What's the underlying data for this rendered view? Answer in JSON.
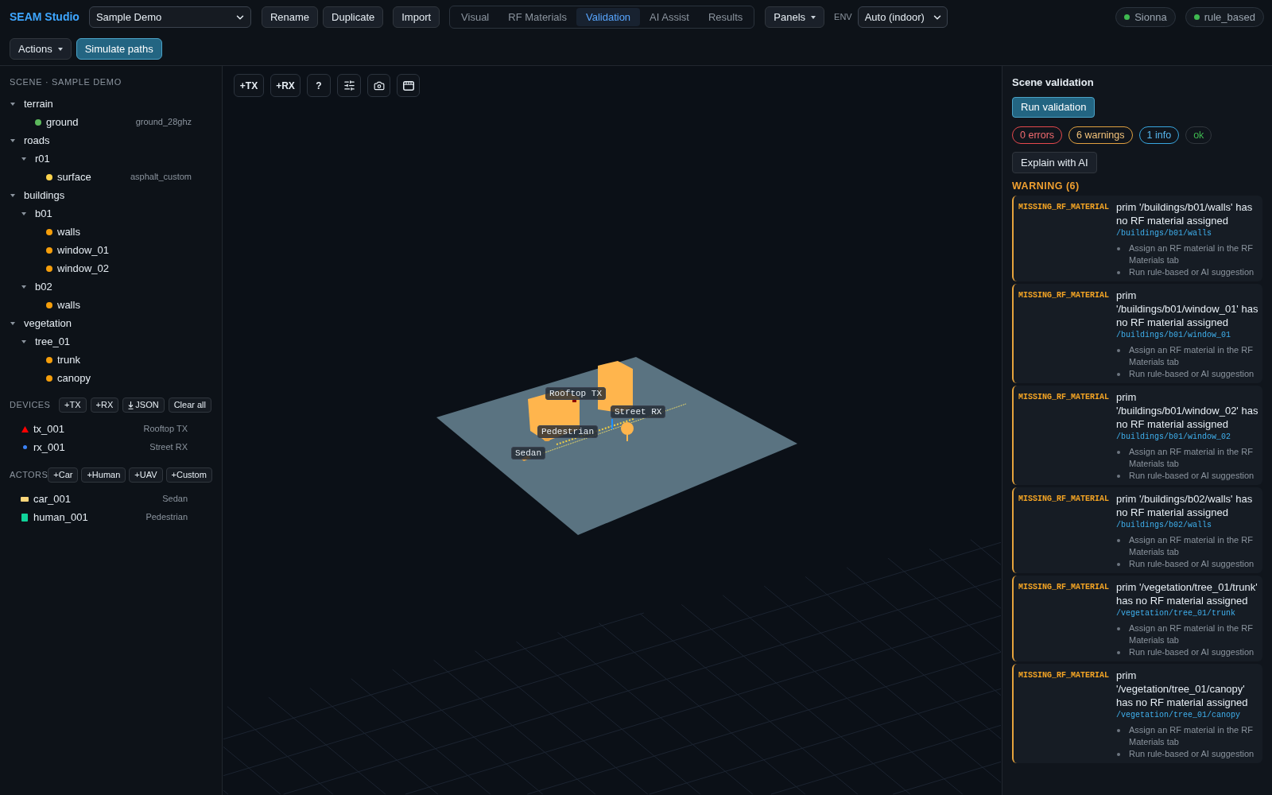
{
  "app": {
    "title": "SEAM Studio"
  },
  "toolbar": {
    "scene_select": {
      "value": "Sample Demo"
    },
    "buttons": [
      "Rename",
      "Duplicate",
      "Import"
    ],
    "tabs": [
      {
        "label": "Visual",
        "selected": false
      },
      {
        "label": "RF Materials",
        "selected": false
      },
      {
        "label": "Validation",
        "selected": true
      },
      {
        "label": "AI Assist",
        "selected": false
      },
      {
        "label": "Results",
        "selected": false
      }
    ],
    "panels_button": "Panels",
    "env": {
      "label": "ENV",
      "value": "Auto (indoor)"
    },
    "status": [
      {
        "label": "Sionna",
        "on": true
      },
      {
        "label": "rule_based",
        "on": true
      }
    ],
    "actions": [
      {
        "label": "Actions",
        "kind": "menu"
      },
      {
        "label": "Simulate paths",
        "kind": "primary"
      }
    ]
  },
  "sidebar": {
    "scene": {
      "heading": "SCENE · SAMPLE DEMO",
      "tree": [
        {
          "label": "terrain",
          "expanded": true,
          "children": [
            {
              "label": "ground",
              "color": "#5cb85c",
              "material": "ground_28ghz"
            }
          ]
        },
        {
          "label": "roads",
          "expanded": true,
          "children": [
            {
              "label": "r01",
              "expanded": true,
              "children": [
                {
                  "label": "surface",
                  "color": "#fcd34d",
                  "material": "asphalt_custom"
                }
              ]
            }
          ]
        },
        {
          "label": "buildings",
          "expanded": true,
          "children": [
            {
              "label": "b01",
              "expanded": true,
              "children": [
                {
                  "label": "walls",
                  "color": "#f59e0b"
                },
                {
                  "label": "window_01",
                  "color": "#f59e0b"
                },
                {
                  "label": "window_02",
                  "color": "#f59e0b"
                }
              ]
            },
            {
              "label": "b02",
              "expanded": true,
              "children": [
                {
                  "label": "walls",
                  "color": "#f59e0b"
                }
              ]
            }
          ]
        },
        {
          "label": "vegetation",
          "expanded": true,
          "children": [
            {
              "label": "tree_01",
              "expanded": true,
              "children": [
                {
                  "label": "trunk",
                  "color": "#f59e0b"
                },
                {
                  "label": "canopy",
                  "color": "#f59e0b"
                }
              ]
            }
          ]
        }
      ]
    },
    "devices": {
      "heading": "DEVICES",
      "buttons": [
        {
          "label": "+TX",
          "kind": "plain"
        },
        {
          "label": "+RX",
          "kind": "plain"
        },
        {
          "label": "JSON",
          "kind": "download"
        },
        {
          "label": "Clear all",
          "kind": "plain"
        }
      ],
      "items": [
        {
          "name": "tx_001",
          "label": "Rooftop TX",
          "kind": "tx",
          "color": "#ff0000"
        },
        {
          "name": "rx_001",
          "label": "Street RX",
          "kind": "rx",
          "color": "#3b82f6"
        }
      ]
    },
    "actors": {
      "heading": "ACTORS",
      "buttons": [
        {
          "label": "+Car",
          "kind": "plain"
        },
        {
          "label": "+Human",
          "kind": "plain"
        },
        {
          "label": "+UAV",
          "kind": "plain"
        },
        {
          "label": "+Custom",
          "kind": "plain"
        }
      ],
      "items": [
        {
          "name": "car_001",
          "label": "Sedan",
          "kind": "car",
          "color": "#fcd67a"
        },
        {
          "name": "human_001",
          "label": "Pedestrian",
          "kind": "human",
          "color": "#10d39a"
        }
      ]
    }
  },
  "viewport": {
    "tools": [
      "+TX",
      "+RX",
      "?"
    ],
    "scene_labels": [
      "Rooftop TX",
      "Street RX",
      "Pedestrian",
      "Sedan"
    ]
  },
  "validation": {
    "title": "Scene validation",
    "run_button": "Run validation",
    "counts": [
      {
        "kind": "error",
        "label": "0 errors"
      },
      {
        "kind": "warning",
        "label": "6 warnings"
      },
      {
        "kind": "info",
        "label": "1 info"
      },
      {
        "kind": "ok",
        "label": "ok"
      }
    ],
    "explain_button": "Explain with AI",
    "groups": [
      {
        "kind": "warning",
        "heading": "WARNING (6)",
        "issues": [
          {
            "code": "MISSING_RF_MATERIAL",
            "message": "prim '/buildings/b01/walls' has no RF material assigned",
            "path": "/buildings/b01/walls",
            "hints": [
              "Assign an RF material in the RF Materials tab",
              "Run rule-based or AI suggestion"
            ]
          },
          {
            "code": "MISSING_RF_MATERIAL",
            "message": "prim '/buildings/b01/window_01' has no RF material assigned",
            "path": "/buildings/b01/window_01",
            "hints": [
              "Assign an RF material in the RF Materials tab",
              "Run rule-based or AI suggestion"
            ]
          },
          {
            "code": "MISSING_RF_MATERIAL",
            "message": "prim '/buildings/b01/window_02' has no RF material assigned",
            "path": "/buildings/b01/window_02",
            "hints": [
              "Assign an RF material in the RF Materials tab",
              "Run rule-based or AI suggestion"
            ]
          },
          {
            "code": "MISSING_RF_MATERIAL",
            "message": "prim '/buildings/b02/walls' has no RF material assigned",
            "path": "/buildings/b02/walls",
            "hints": [
              "Assign an RF material in the RF Materials tab",
              "Run rule-based or AI suggestion"
            ]
          },
          {
            "code": "MISSING_RF_MATERIAL",
            "message": "prim '/vegetation/tree_01/trunk' has no RF material assigned",
            "path": "/vegetation/tree_01/trunk",
            "hints": [
              "Assign an RF material in the RF Materials tab",
              "Run rule-based or AI suggestion"
            ]
          },
          {
            "code": "MISSING_RF_MATERIAL",
            "message": "prim '/vegetation/tree_01/canopy' has no RF material assigned",
            "path": "/vegetation/tree_01/canopy",
            "hints": [
              "Assign an RF material in the RF Materials tab",
              "Run rule-based or AI suggestion"
            ]
          }
        ]
      }
    ]
  }
}
